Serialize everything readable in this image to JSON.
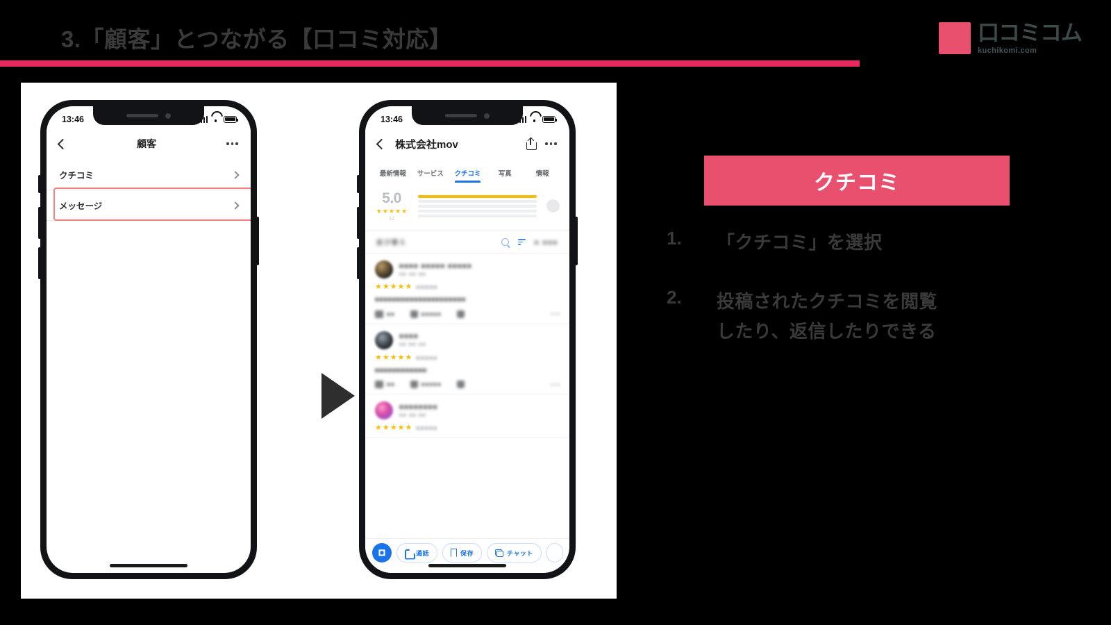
{
  "slide": {
    "title": "3.「顧客」とつながる【口コミ対応】"
  },
  "logo": {
    "main": "口コミコム",
    "sub": "kuchikomi.com",
    "mark_color": "#E8506E"
  },
  "colors": {
    "accent_bar": "#E8285F",
    "banner": "#E8506E",
    "highlight_border": "#F58080",
    "tab_active": "#1a73e8",
    "star": "#fbbc04"
  },
  "phone1": {
    "status": {
      "time": "13:46"
    },
    "nav": {
      "title": "顧客"
    },
    "rows": [
      {
        "label": "クチコミ",
        "highlighted": true
      },
      {
        "label": "メッセージ",
        "highlighted": false
      }
    ]
  },
  "phone2": {
    "status": {
      "time": "13:46"
    },
    "nav": {
      "title": "株式会社mov"
    },
    "tabs": [
      {
        "label": "最新情報",
        "active": false
      },
      {
        "label": "サービス",
        "active": false
      },
      {
        "label": "クチコミ",
        "active": true
      },
      {
        "label": "写真",
        "active": false
      },
      {
        "label": "情報",
        "active": false
      }
    ],
    "rating": {
      "score": "5.0",
      "stars": "★★★★★",
      "count": "12"
    },
    "filter": {
      "label": "並び替え",
      "search_icon": "search-icon",
      "sort_icon": "sort-icon"
    },
    "reviews": [
      {
        "name": "■■■■ ■■■■■ ■■■■■",
        "sub": "■■ ■■ ■■",
        "stars": "★★★★★",
        "date": "■■■■■",
        "body": "■■■■■■■■■■■■■■■■■■■■■",
        "actions": [
          "■■",
          "■■■■■",
          ""
        ]
      },
      {
        "name": "■■■■",
        "sub": "■■ ■■ ■■",
        "stars": "★★★★★",
        "date": "■■■■■",
        "body": "■■■■■■■■■■■■",
        "actions": [
          "■■",
          "■■■■■",
          ""
        ]
      },
      {
        "name": "■■■■■■■■",
        "sub": "■■ ■■ ■■",
        "stars": "★★★★★",
        "date": "■■■■■",
        "body": "",
        "actions": []
      }
    ],
    "action_bar": {
      "directions_label": "directions-fab",
      "buttons": [
        {
          "label": "通話",
          "icon": "phone-icon"
        },
        {
          "label": "保存",
          "icon": "bookmark-icon"
        },
        {
          "label": "チャット",
          "icon": "chat-icon"
        }
      ]
    }
  },
  "panel": {
    "banner_label": "クチコミ",
    "steps": [
      {
        "num": "1.",
        "text": "「クチコミ」を選択"
      },
      {
        "num": "2.",
        "text": "投稿されたクチコミを閲覧\nしたり、返信したりできる"
      }
    ]
  }
}
